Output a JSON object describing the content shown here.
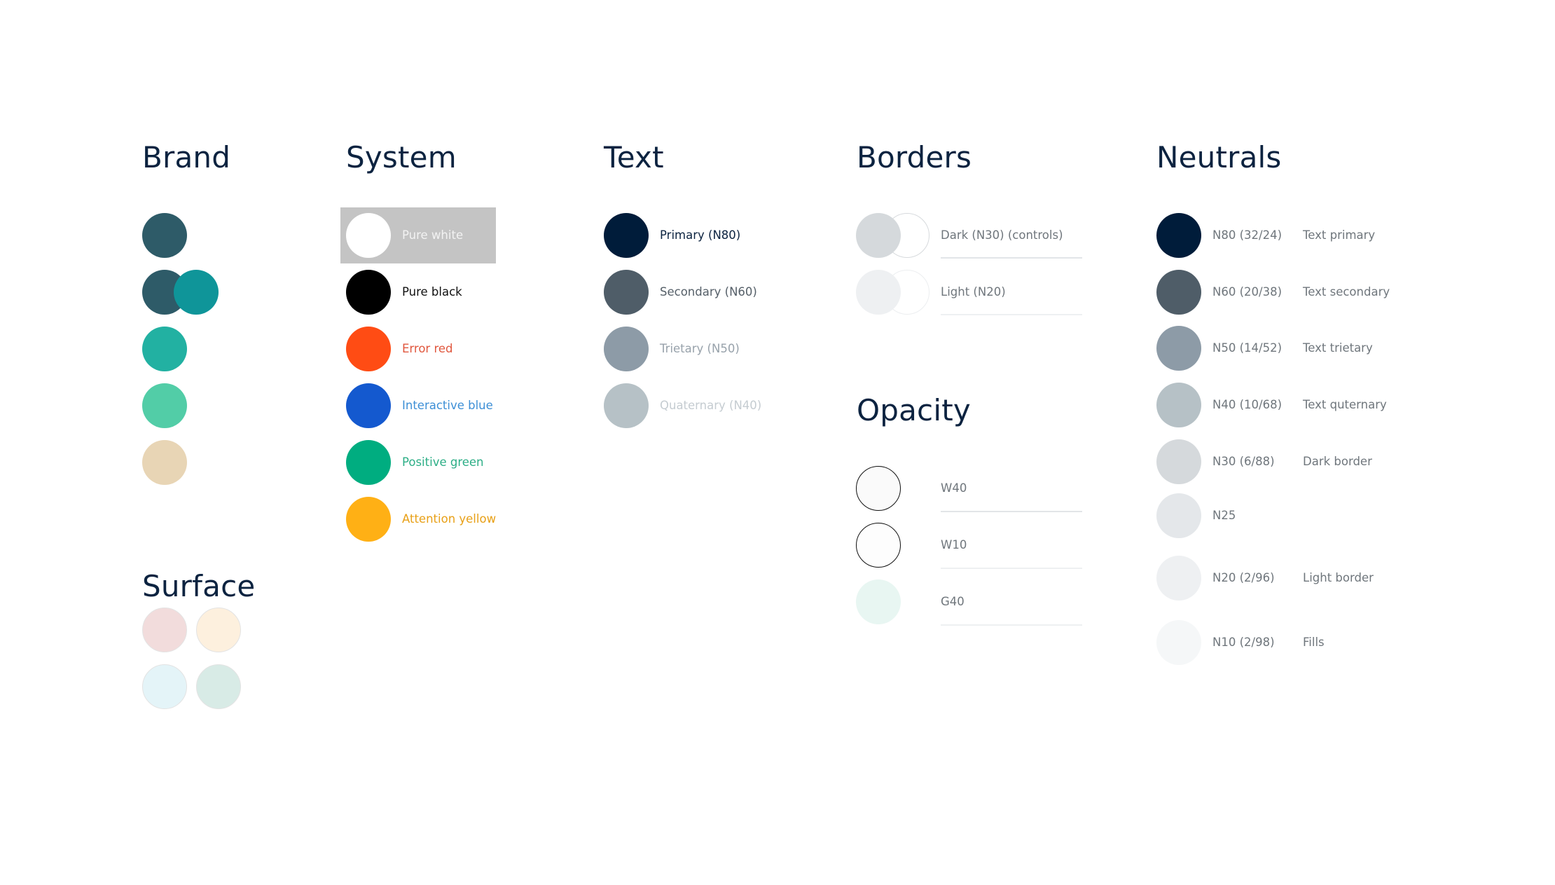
{
  "sections": {
    "brand": {
      "title": "Brand",
      "colors": [
        "#2e5b68",
        "#0f9599",
        "#22b1a2",
        "#52cda7",
        "#e8d5b5"
      ],
      "overlap_pair": [
        "#2e5b68",
        "#0f9599"
      ]
    },
    "surface": {
      "title": "Surface",
      "colors": [
        "#f2dcdc",
        "#fdf0de",
        "#e4f4f8",
        "#d8ebe6"
      ]
    },
    "system": {
      "title": "System",
      "items": [
        {
          "label": "Pure white",
          "color": "#ffffff",
          "text_color": "#f3f3f3"
        },
        {
          "label": "Pure black",
          "color": "#000000",
          "text_color": "#111111"
        },
        {
          "label": "Error red",
          "color": "#ff4c14",
          "text_color": "#e0573e"
        },
        {
          "label": "Interactive blue",
          "color": "#1459cf",
          "text_color": "#3d8fd6"
        },
        {
          "label": "Positive green",
          "color": "#00ad80",
          "text_color": "#2cae86"
        },
        {
          "label": "Attention yellow",
          "color": "#ffb015",
          "text_color": "#e8a017"
        }
      ]
    },
    "text": {
      "title": "Text",
      "items": [
        {
          "label": "Primary (N80)",
          "color": "#001c3a",
          "text_color": "#0c2340"
        },
        {
          "label": "Secondary (N60)",
          "color": "#4f5d68",
          "text_color": "#555f68"
        },
        {
          "label": "Trietary (N50)",
          "color": "#8d9ba7",
          "text_color": "#98a2ab"
        },
        {
          "label": "Quaternary (N40)",
          "color": "#b6c1c6",
          "text_color": "#c5ccd1"
        }
      ]
    },
    "borders": {
      "title": "Borders",
      "items": [
        {
          "label": "Dark (N30) (controls)",
          "color": "#d5d9dc",
          "ring": "#d7dadd"
        },
        {
          "label": "Light (N20)",
          "color": "#eef0f2",
          "ring": "#eceef0"
        }
      ]
    },
    "opacity": {
      "title": "Opacity",
      "items": [
        {
          "label": "W40",
          "color": "#fafafa",
          "stroke": "#111111"
        },
        {
          "label": "W10",
          "color": "#fdfdfd",
          "stroke": "#111111"
        },
        {
          "label": "G40",
          "color": "#e8f6f2",
          "stroke": "none"
        }
      ]
    },
    "neutrals": {
      "title": "Neutrals",
      "items": [
        {
          "code": "N80 (32/24)",
          "role": "Text primary",
          "color": "#001c3a"
        },
        {
          "code": "N60 (20/38)",
          "role": "Text secondary",
          "color": "#4f5d68"
        },
        {
          "code": "N50 (14/52)",
          "role": "Text trietary",
          "color": "#8d9ba7"
        },
        {
          "code": "N40 (10/68)",
          "role": "Text quternary",
          "color": "#b6c1c6"
        },
        {
          "code": "N30 (6/88)",
          "role": "Dark border",
          "color": "#d5d9dc"
        },
        {
          "code": "N25",
          "role": "",
          "color": "#e4e7ea"
        },
        {
          "code": "N20 (2/96)",
          "role": "Light border",
          "color": "#eef0f2"
        },
        {
          "code": "N10 (2/98)",
          "role": "Fills",
          "color": "#f5f7f8"
        }
      ]
    }
  }
}
